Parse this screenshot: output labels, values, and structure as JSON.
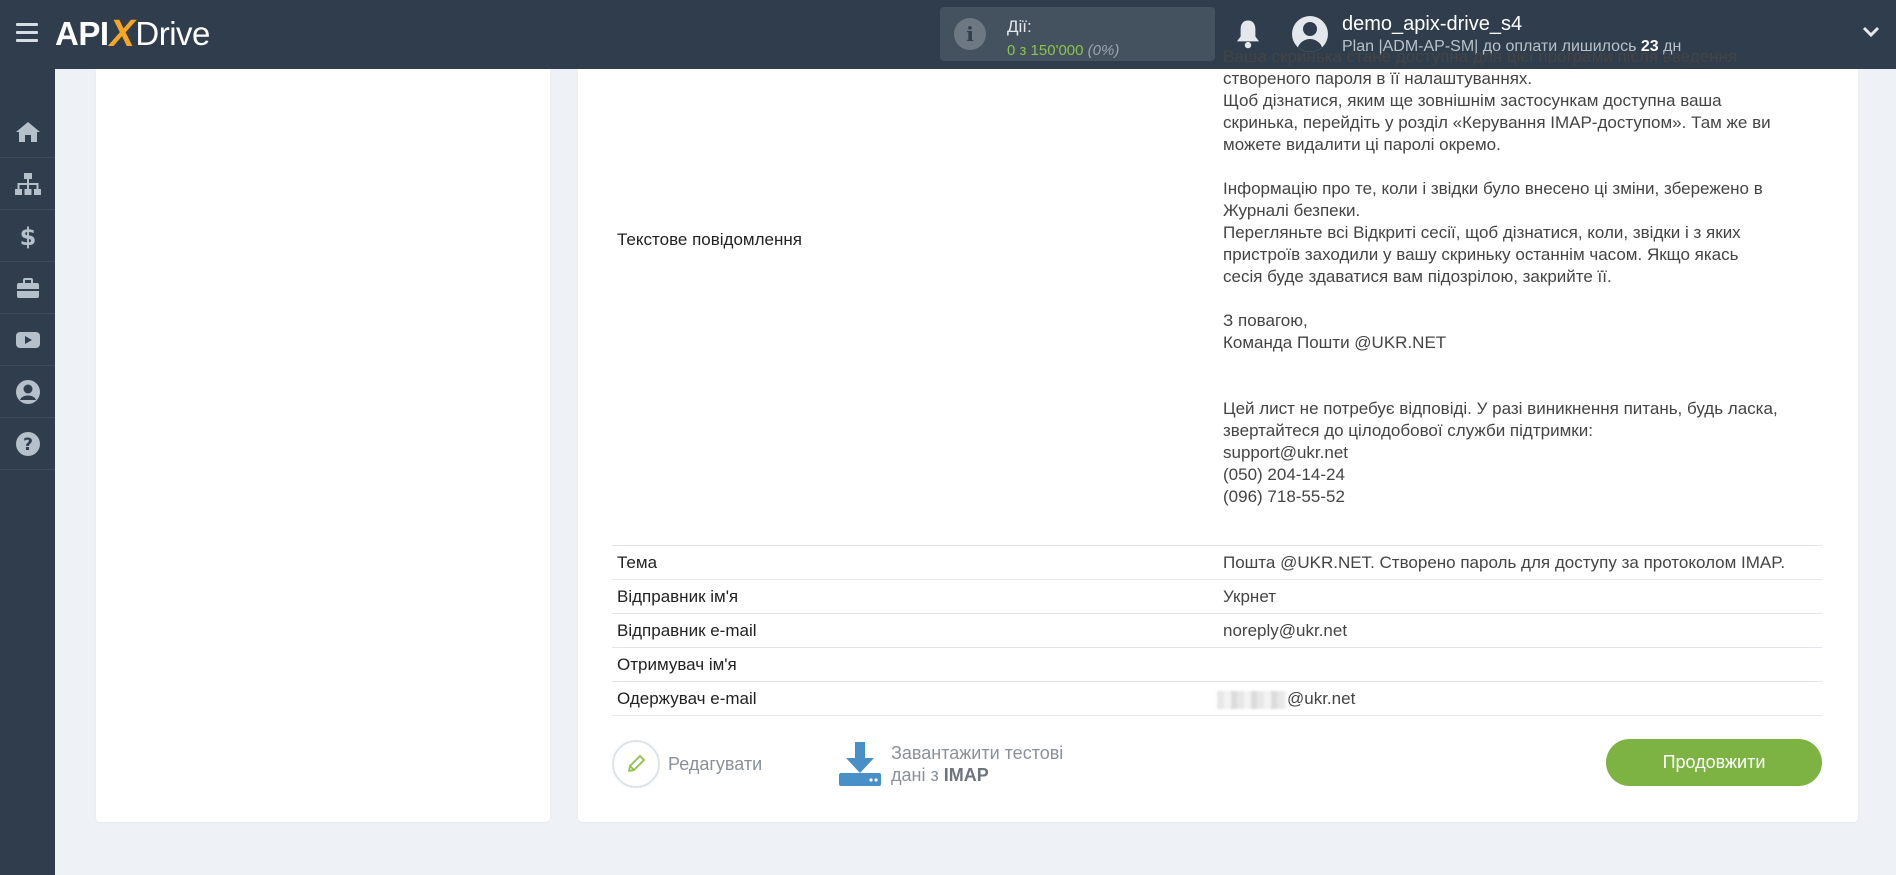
{
  "header": {
    "logo_api": "API",
    "logo_x": "X",
    "logo_drive": "Drive",
    "actions_label": "Дії:",
    "actions_count": "0 з 150'000",
    "actions_percent": "(0%)",
    "user_name": "demo_apix-drive_s4",
    "user_plan_prefix": "Plan |ADM-AP-SM| до оплати лишилось ",
    "user_plan_days": "23",
    "user_plan_suffix": " дн"
  },
  "sidebar": {
    "items": [
      {
        "icon": "home-icon"
      },
      {
        "icon": "sitemap-icon"
      },
      {
        "icon": "dollar-icon"
      },
      {
        "icon": "briefcase-icon"
      },
      {
        "icon": "youtube-icon"
      },
      {
        "icon": "user-icon"
      },
      {
        "icon": "help-icon"
      }
    ]
  },
  "message": {
    "label": "Текстове повідомлення",
    "text_top": "Ваша скринька стане доступна для цієї програми після введення\nствореного пароля в її налаштуваннях.\nЩоб дізнатися, яким ще зовнішнім застосункам доступна ваша\nскринька, перейдіть у розділ «Керування IMAP-доступом». Там же ви\nможете видалити ці паролі окремо.",
    "text_middle": "Інформацію про те, коли і звідки було внесено ці зміни, збережено в\nЖурналі безпеки.\nПерегляньте всі Відкриті сесії, щоб дізнатися, коли, звідки і з яких\nпристроїв заходили у вашу скриньку останнім часом. Якщо якась\nсесія буде здаватися вам підозрілою, закрийте її.",
    "text_sign": "З повагою,\nКоманда Пошти @UKR.NET",
    "text_footer": "Цей лист не потребує відповіді. У разі виникнення питань, будь ласка,\nзвертайтеся до цілодобової служби підтримки:\nsupport@ukr.net\n(050) 204-14-24\n(096) 718-55-52"
  },
  "rows": [
    {
      "key": "Тема",
      "value": "Пошта @UKR.NET. Створено пароль для доступу за протоколом IMAP."
    },
    {
      "key": "Відправник ім'я",
      "value": "Укрнет"
    },
    {
      "key": "Відправник e-mail",
      "value": "noreply@ukr.net"
    },
    {
      "key": "Отримувач ім'я",
      "value": ""
    },
    {
      "key": "Одержувач e-mail",
      "value": "@ukr.net"
    }
  ],
  "buttons": {
    "edit": "Редагувати",
    "download_line1": "Завантажити тестові",
    "download_line2_prefix": "дані з ",
    "download_line2_bold": "IMAP",
    "continue": "Продовжити"
  },
  "colors": {
    "topbar": "#2f3d4c",
    "accent_green": "#7cb342",
    "logo_x": "#f5a623",
    "download_icon": "#4a90c8"
  }
}
